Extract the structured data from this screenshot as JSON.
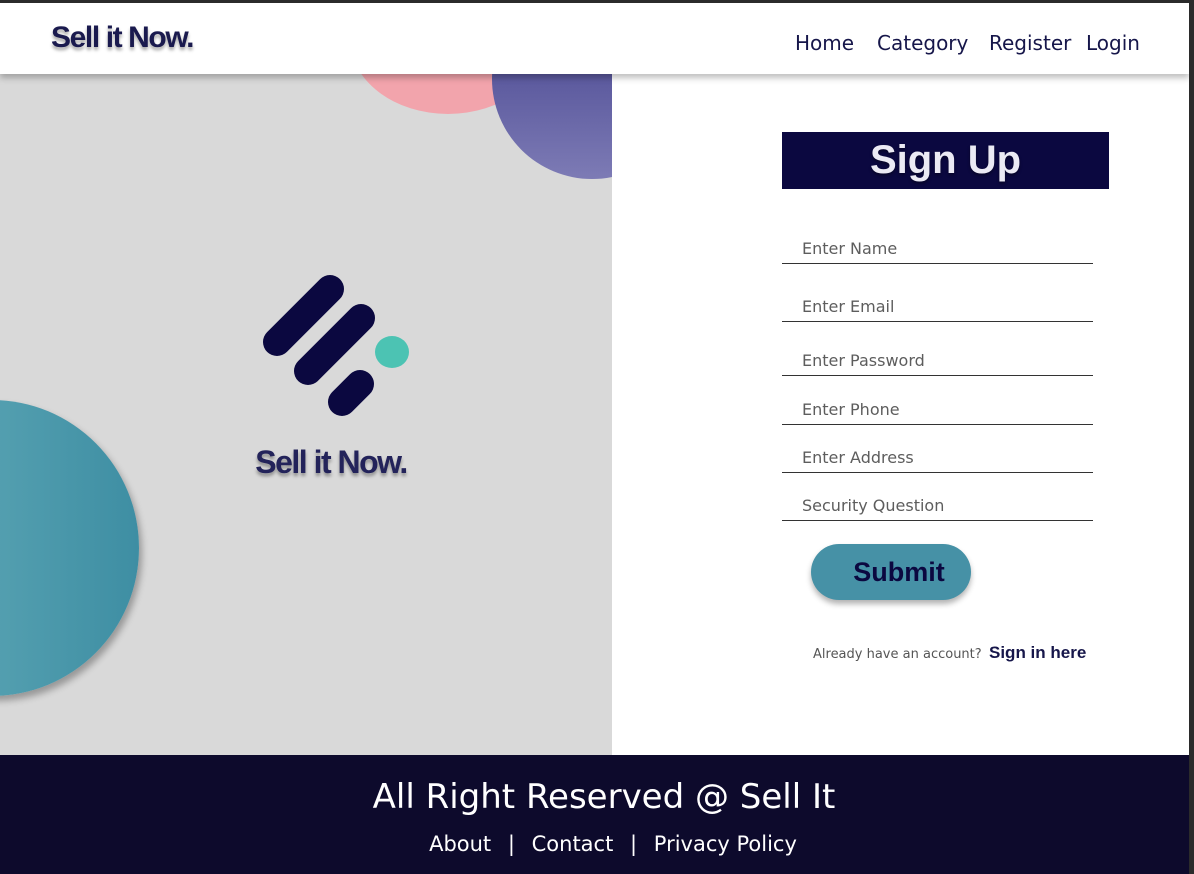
{
  "header": {
    "brand": "Sell it Now.",
    "nav": [
      "Home",
      "Category",
      "Register",
      "Login"
    ]
  },
  "hero": {
    "logo_text": "Sell it Now."
  },
  "form": {
    "title": "Sign Up",
    "fields": {
      "name": "Enter Name",
      "email": "Enter Email",
      "password": "Enter Password",
      "phone": "Enter Phone",
      "address": "Enter Address",
      "security": "Security Question"
    },
    "submit_label": "Submit",
    "already_text": "Already have an account?",
    "signin_label": "Sign in here"
  },
  "footer": {
    "copyright": "All Right Reserved @ Sell It",
    "links": [
      "About",
      "Contact",
      "Privacy Policy"
    ],
    "separator": "|"
  },
  "colors": {
    "navy": "#0b0840",
    "brand_text": "#1a1a4e",
    "teal": "#4691a6",
    "mint_dot": "#4cc3b3",
    "pink": "#f2a4ac",
    "purple": "#3c3a88",
    "footer_bg": "#0d0a2c",
    "panel_gray": "#d9d9d9"
  }
}
